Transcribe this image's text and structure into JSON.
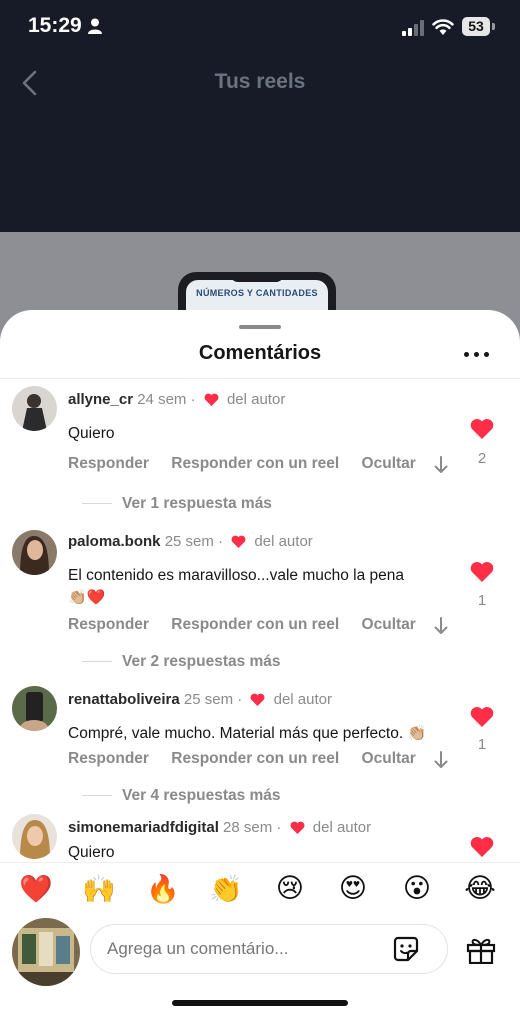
{
  "status_bar": {
    "time": "15:29",
    "battery": "53"
  },
  "nav": {
    "title": "Tus reels"
  },
  "background_preview": {
    "text": "NÚMEROS Y CANTIDADES"
  },
  "sheet": {
    "title": "Comentários"
  },
  "comments": [
    {
      "username": "allyne_cr",
      "age": "24 sem",
      "author_liked": "del autor",
      "text": "Quiero",
      "actions": {
        "reply": "Responder",
        "reply_reel": "Responder con un reel",
        "hide": "Ocultar"
      },
      "likes": "2",
      "more_replies": "Ver 1 respuesta más"
    },
    {
      "username": "paloma.bonk",
      "age": "25 sem",
      "author_liked": "del autor",
      "text": "El contenido es maravilloso...vale mucho la pena",
      "text_emojis": "👏🏼❤️",
      "actions": {
        "reply": "Responder",
        "reply_reel": "Responder con un reel",
        "hide": "Ocultar"
      },
      "likes": "1",
      "more_replies": "Ver 2 respuestas más"
    },
    {
      "username": "renattaboliveira",
      "age": "25 sem",
      "author_liked": "del autor",
      "text": "Compré, vale mucho. Material más que perfecto. 👏🏼",
      "actions": {
        "reply": "Responder",
        "reply_reel": "Responder con un reel",
        "hide": "Ocultar"
      },
      "likes": "1",
      "more_replies": "Ver 4 respuestas más"
    },
    {
      "username": "simonemariadfdigital",
      "age": "28 sem",
      "author_liked": "del autor",
      "text": "Quiero"
    }
  ],
  "quick_emojis": [
    "❤️",
    "🙌",
    "🔥",
    "👏",
    "😢",
    "😍",
    "😮",
    "😂"
  ],
  "composer": {
    "placeholder": "Agrega un comentário..."
  },
  "colors": {
    "like_red": "#ff2d46",
    "dark_header": "#161b27"
  },
  "icons": [
    "back-icon",
    "person-icon",
    "signal-icon",
    "wifi-icon",
    "more-icon",
    "heart-icon",
    "down-arrow-icon",
    "sticker-icon",
    "gift-icon"
  ]
}
